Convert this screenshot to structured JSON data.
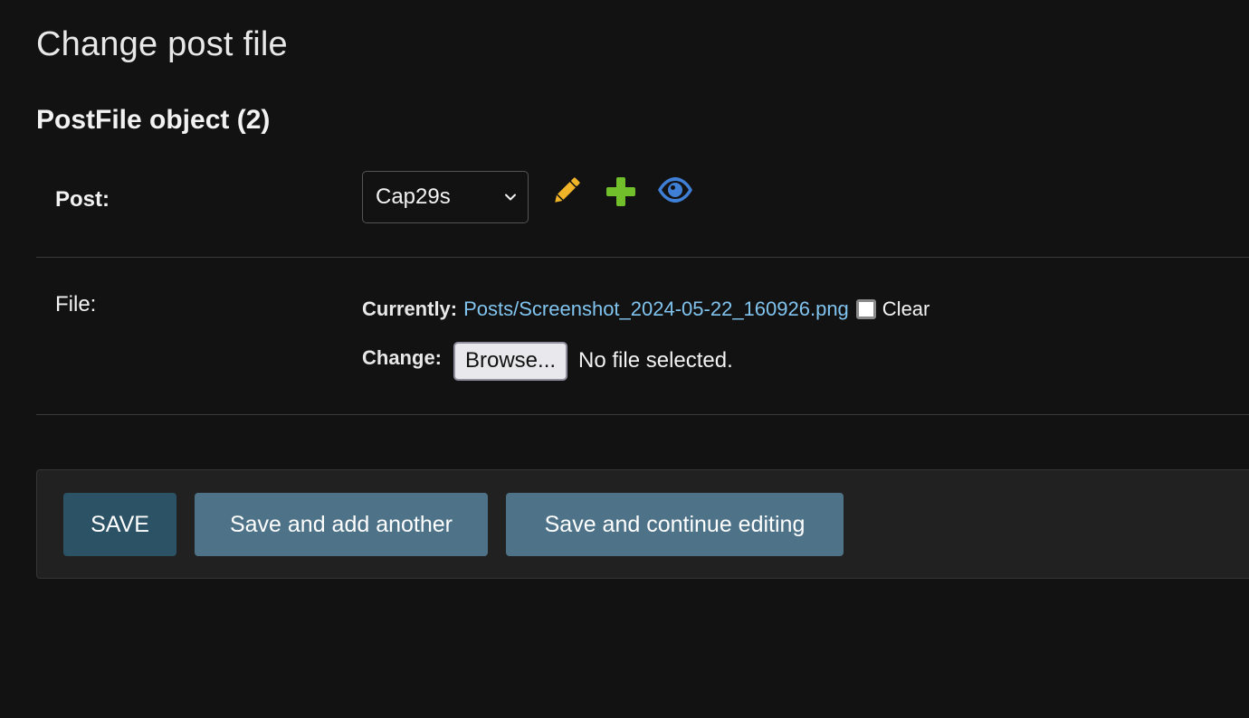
{
  "page": {
    "title": "Change post file",
    "object_title": "PostFile object (2)"
  },
  "post_field": {
    "label": "Post:",
    "selected_value": "Cap29s",
    "actions": {
      "edit_icon": "pencil-icon",
      "add_icon": "plus-icon",
      "view_icon": "eye-icon"
    }
  },
  "file_field": {
    "label": "File:",
    "currently_label": "Currently:",
    "current_file": "Posts/Screenshot_2024-05-22_160926.png",
    "clear_label": "Clear",
    "clear_checked": false,
    "change_label": "Change:",
    "browse_label": "Browse...",
    "no_file_text": "No file selected."
  },
  "submit_row": {
    "save_label": "SAVE",
    "save_add_another_label": "Save and add another",
    "save_continue_label": "Save and continue editing"
  },
  "colors": {
    "background": "#121212",
    "link": "#81c4ef",
    "edit_icon": "#f0b429",
    "add_icon": "#70bf2b",
    "view_icon": "#3f7fd6",
    "primary_button": "#2c5265",
    "secondary_button": "#4e7388"
  }
}
